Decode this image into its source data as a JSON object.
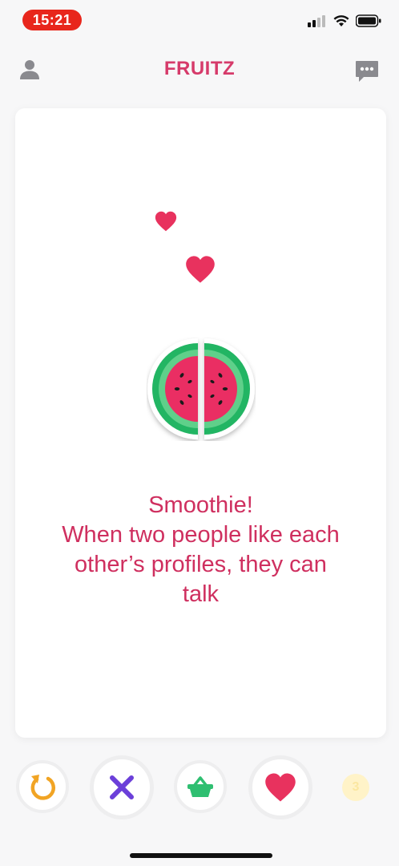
{
  "status_bar": {
    "time": "15:21",
    "icons": [
      "signal-icon",
      "wifi-icon",
      "battery-icon"
    ]
  },
  "header": {
    "title": "FRUITZ",
    "left_icon": "user-icon",
    "right_icon": "chat-icon"
  },
  "card": {
    "message_lines": [
      "Smoothie!",
      "When two people like each",
      "other’s profiles, they can",
      "talk"
    ],
    "illustration": "watermelon-icon",
    "decorations": [
      "heart-icon",
      "heart-icon"
    ]
  },
  "actions": [
    {
      "name": "undo",
      "icon": "undo-icon"
    },
    {
      "name": "dislike",
      "icon": "x-icon"
    },
    {
      "name": "basket",
      "icon": "basket-icon"
    },
    {
      "name": "like",
      "icon": "heart-icon"
    },
    {
      "name": "boost",
      "icon": "boost-icon",
      "count": "3"
    }
  ],
  "colors": {
    "brand": "#d63a6a",
    "time_pill": "#e8261c",
    "dislike": "#6b3fd9",
    "basket": "#2fbf71",
    "like": "#e8325e",
    "undo": "#f1a424",
    "watermelon_rind": "#22b564",
    "watermelon_flesh": "#ea2f63"
  }
}
